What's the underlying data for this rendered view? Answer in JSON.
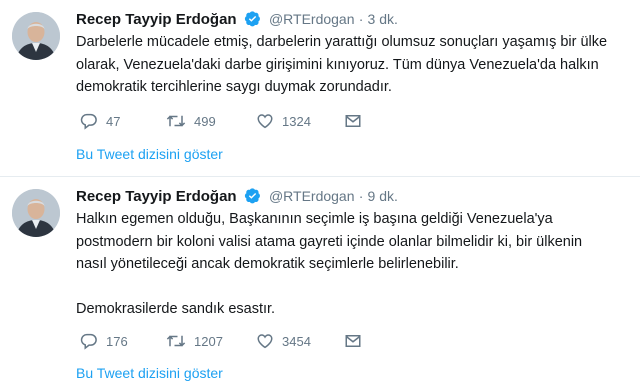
{
  "colors": {
    "link": "#1da1f2",
    "muted": "#657786",
    "text": "#14171a",
    "verified": "#1da1f2"
  },
  "tweets": [
    {
      "name": "Recep Tayyip Erdoğan",
      "handle": "@RTErdogan",
      "separator": "·",
      "time": "3 dk.",
      "text": "Darbelerle mücadele etmiş, darbelerin yarattığı olumsuz sonuçları yaşamış bir ülke\nolarak, Venezuela'daki darbe girişimini kınıyoruz. Tüm dünya Venezuela'da halkın\ndemokratik tercihlerine saygı duymak zorundadır.",
      "replies": "47",
      "retweets": "499",
      "likes": "1324",
      "thread_link": "Bu Tweet dizisini göster"
    },
    {
      "name": "Recep Tayyip Erdoğan",
      "handle": "@RTErdogan",
      "separator": "·",
      "time": "9 dk.",
      "text": "Halkın egemen olduğu, Başkanının seçimle iş başına geldiği Venezuela'ya\npostmodern bir koloni valisi atama gayreti içinde olanlar bilmelidir ki, bir ülkenin\nnasıl yönetileceği ancak demokratik seçimlerle belirlenebilir.\n\nDemokrasilerde sandık esastır.",
      "replies": "176",
      "retweets": "1207",
      "likes": "3454",
      "thread_link": "Bu Tweet dizisini göster"
    }
  ]
}
